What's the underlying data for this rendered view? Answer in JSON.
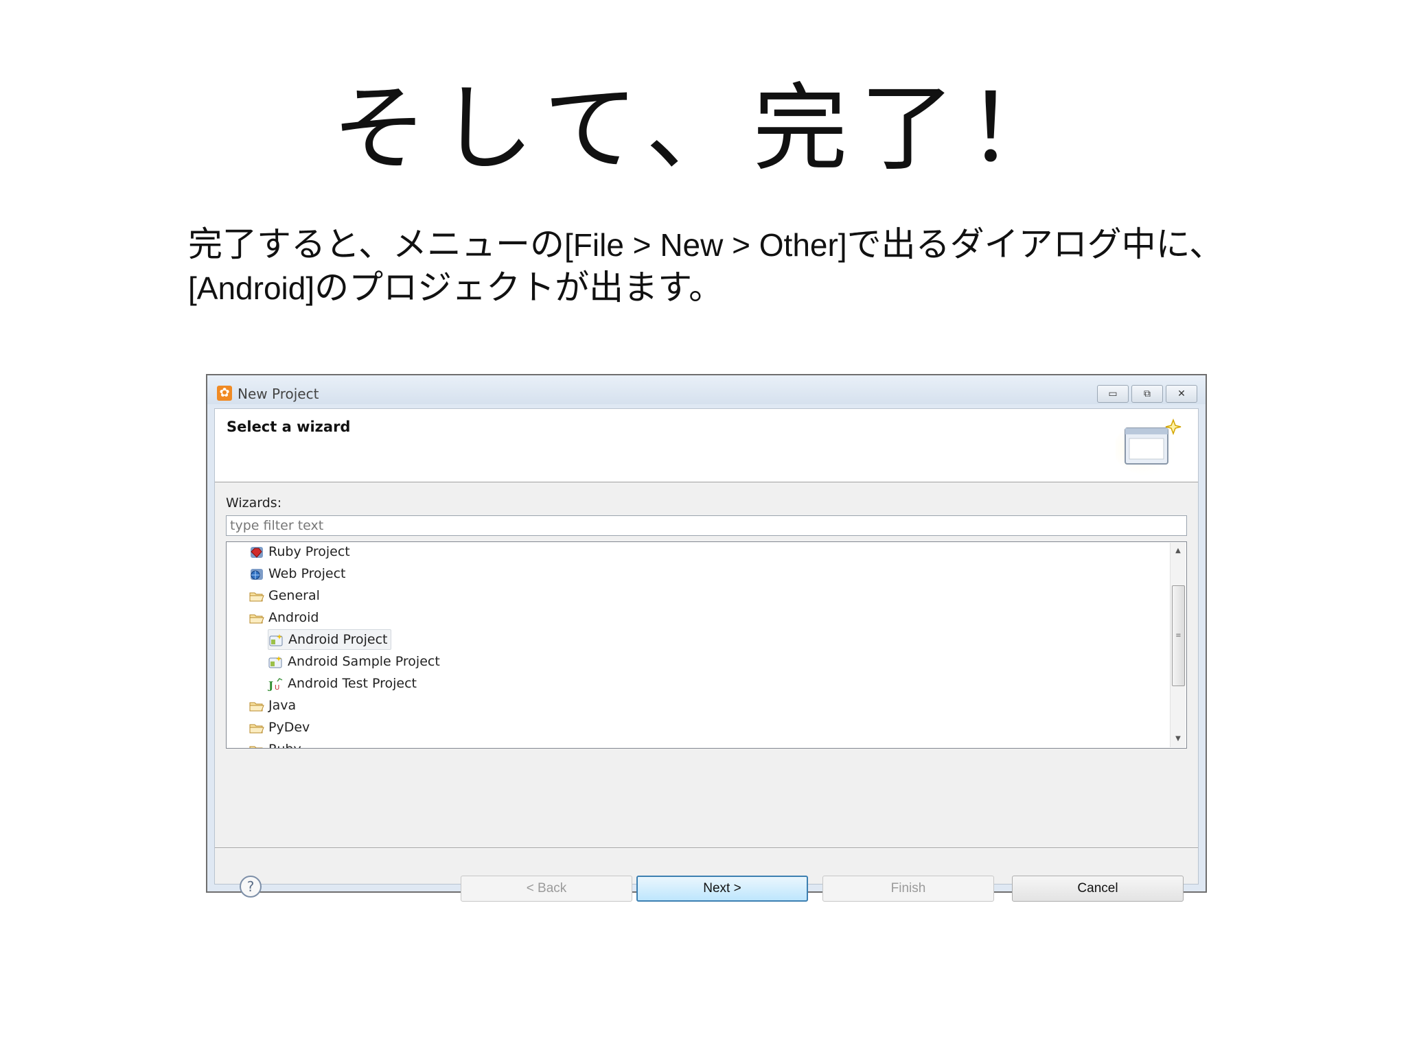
{
  "slide": {
    "title": "そして、完了！",
    "body_line1_a": "完了すると、メニューの",
    "body_line1_b": "[File > New > Other]",
    "body_line1_c": "で出るダイアログ中に、",
    "body_line2_a": "[Android]",
    "body_line2_b": "のプロジェクトが出ます。"
  },
  "dialog": {
    "window_title": "New Project",
    "banner_title": "Select a wizard",
    "wizards_label": "Wizards:",
    "filter_placeholder": "type filter text",
    "tree": [
      {
        "label": "Ruby Project",
        "icon": "ruby-project-icon"
      },
      {
        "label": "Web Project",
        "icon": "web-project-icon"
      },
      {
        "label": "General",
        "icon": "folder-icon"
      },
      {
        "label": "Android",
        "icon": "folder-icon"
      },
      {
        "label": "Android Project",
        "icon": "android-project-icon",
        "selected": true
      },
      {
        "label": "Android Sample Project",
        "icon": "android-project-icon"
      },
      {
        "label": "Android Test Project",
        "icon": "junit-icon"
      },
      {
        "label": "Java",
        "icon": "folder-icon"
      },
      {
        "label": "PyDev",
        "icon": "folder-icon"
      },
      {
        "label": "Ruby",
        "icon": "folder-icon"
      }
    ],
    "buttons": {
      "back": "< Back",
      "next": "Next >",
      "finish": "Finish",
      "cancel": "Cancel"
    },
    "window_controls": {
      "minimize": "▭",
      "maximize": "⧉",
      "close": "✕"
    }
  }
}
